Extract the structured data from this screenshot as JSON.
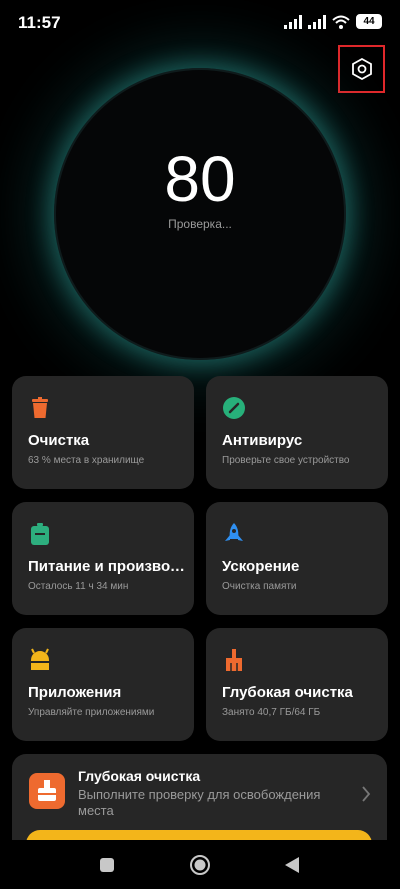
{
  "status_bar": {
    "time": "11:57",
    "battery": "44"
  },
  "header": {
    "settings_icon": "hexagon-settings-icon"
  },
  "score": {
    "value": "80",
    "label": "Проверка..."
  },
  "tiles": [
    {
      "title": "Очистка",
      "subtitle": "63 % места в хранилище",
      "icon": "trash-can-icon",
      "color": "#ee6a2f"
    },
    {
      "title": "Антивирус",
      "subtitle": "Проверьте свое устройство",
      "icon": "shield-scan-icon",
      "color": "#27b07a"
    },
    {
      "title": "Питание и производ…",
      "subtitle": "Осталось 11 ч 34 мин",
      "icon": "battery-icon",
      "color": "#2dae7e"
    },
    {
      "title": "Ускорение",
      "subtitle": "Очистка памяти",
      "icon": "rocket-icon",
      "color": "#2f8ff0"
    },
    {
      "title": "Приложения",
      "subtitle": "Управляйте приложениями",
      "icon": "android-icon",
      "color": "#f3b51a"
    },
    {
      "title": "Глубокая очистка",
      "subtitle": "Занято 40,7 ГБ/64 ГБ",
      "icon": "broom-icon",
      "color": "#ee6a2f"
    }
  ],
  "banner": {
    "title": "Глубокая очистка",
    "text": "Выполните проверку для освобождения места",
    "icon": "deep-clean-icon",
    "button_color": "#f3b51a"
  },
  "nav": {
    "recents_icon": "square-icon",
    "home_icon": "circle-icon",
    "back_icon": "triangle-back-icon"
  }
}
